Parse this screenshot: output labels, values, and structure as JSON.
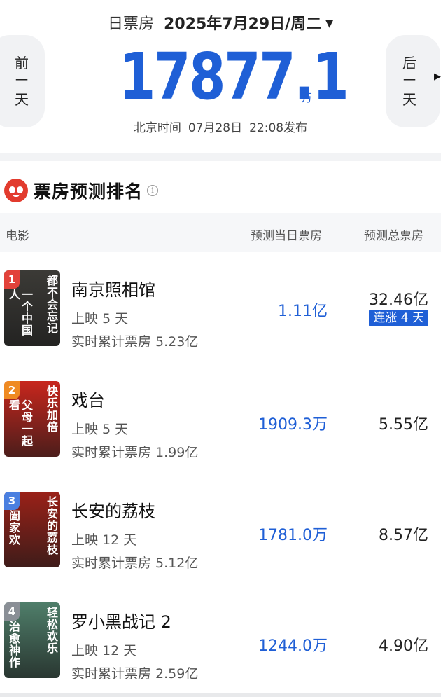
{
  "header": {
    "label": "日票房",
    "date": "2025年7月29日/周二",
    "caret": "▼",
    "prev": [
      "前",
      "一",
      "天"
    ],
    "next": [
      "后",
      "一",
      "天"
    ],
    "total": "17877.1",
    "unit": "万",
    "publish": [
      "北京时间",
      "07月28日",
      "22:08发布"
    ]
  },
  "ranking": {
    "title": "票房预测排名",
    "info": "i",
    "columns": {
      "movie": "电影",
      "day": "预测当日票房",
      "total": "预测总票房"
    },
    "movies": [
      {
        "rank": "1",
        "title": "南京照相馆",
        "days": "上映 5 天",
        "cumulative": "实时累计票房 5.23亿",
        "forecast_day": "1.11亿",
        "forecast_total": "32.46亿",
        "streak": "连涨 4 天",
        "badge_color": "#e2423a",
        "poster_bg": "#3b3a36",
        "poster_text_left": "一个中国人",
        "poster_text_right": "都不会忘记"
      },
      {
        "rank": "2",
        "title": "戏台",
        "days": "上映 5 天",
        "cumulative": "实时累计票房 1.99亿",
        "forecast_day": "1909.3万",
        "forecast_total": "5.55亿",
        "badge_color": "#ef8a22",
        "poster_bg": "#c8261d",
        "poster_text_left": "父母一起看",
        "poster_text_right": "快乐加倍"
      },
      {
        "rank": "3",
        "title": "长安的荔枝",
        "days": "上映 12 天",
        "cumulative": "实时累计票房 5.12亿",
        "forecast_day": "1781.0万",
        "forecast_total": "8.57亿",
        "badge_color": "#4a7fe0",
        "poster_bg": "#9a2118",
        "poster_text_left": "阖家欢",
        "poster_text_right": "长安的荔枝"
      },
      {
        "rank": "4",
        "title": "罗小黑战记 2",
        "days": "上映 12 天",
        "cumulative": "实时累计票房 2.59亿",
        "forecast_day": "1244.0万",
        "forecast_total": "4.90亿",
        "badge_color": "#8a8f96",
        "poster_bg": "#4f7e6a",
        "poster_text_left": "治愈神作",
        "poster_text_right": "轻松欢乐"
      }
    ]
  }
}
